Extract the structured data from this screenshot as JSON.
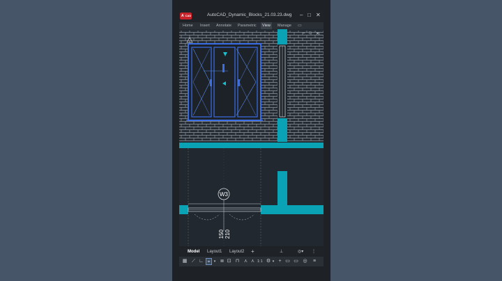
{
  "app": {
    "badge": "A",
    "badge_sub": "CAD"
  },
  "window": {
    "title": "AutoCAD_Dynamic_Blocks_21.03.23.dwg",
    "minimize": "–",
    "restore": "□",
    "close": "✕"
  },
  "ribbon": {
    "tabs": [
      {
        "label": "Home",
        "active": false
      },
      {
        "label": "Insert",
        "active": false
      },
      {
        "label": "Annotate",
        "active": false
      },
      {
        "label": "Parametric",
        "active": false
      },
      {
        "label": "View",
        "active": true
      },
      {
        "label": "Manage",
        "active": false
      }
    ]
  },
  "viewport_controls": {
    "minimize": "–",
    "restore": "□",
    "close": "✕"
  },
  "drawing": {
    "tag": "W3",
    "dim_1": "150",
    "dim_2": "210",
    "wall_color": "#0aa3b5",
    "selection_color": "#3a6ee8",
    "brick_color": "#9aa0a6"
  },
  "layout_tabs": {
    "model": "Model",
    "layout1": "Layout1",
    "layout2": "Layout2",
    "add": "+"
  },
  "statusbar": {
    "scale": "1:1"
  }
}
